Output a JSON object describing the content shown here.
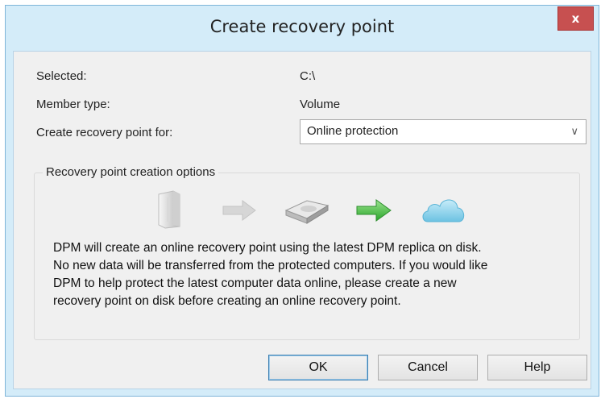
{
  "window": {
    "title": "Create recovery point",
    "close_label": "x"
  },
  "fields": {
    "selected_label": "Selected:",
    "selected_value": "C:\\",
    "member_type_label": "Member type:",
    "member_type_value": "Volume",
    "create_for_label": "Create recovery point for:",
    "create_for_value": "Online protection"
  },
  "options_group": {
    "title": "Recovery point creation options",
    "description_lines": [
      "DPM will create an online recovery point using the latest DPM replica on disk.",
      "No new data will be transferred from the protected computers. If you would like",
      "DPM to help protect the latest computer data online, please create a new",
      "recovery point on disk before creating an online recovery point."
    ],
    "icons": [
      "server-icon",
      "gray-arrow-icon",
      "disk-icon",
      "green-arrow-icon",
      "cloud-icon"
    ]
  },
  "buttons": {
    "ok": "OK",
    "cancel": "Cancel",
    "help": "Help"
  },
  "colors": {
    "title_bg": "#d4ecf9",
    "close_bg": "#c75050",
    "client_bg": "#f0f0f0",
    "accent_arrow": "#3fbf3f",
    "cloud": "#7ecbe6"
  }
}
